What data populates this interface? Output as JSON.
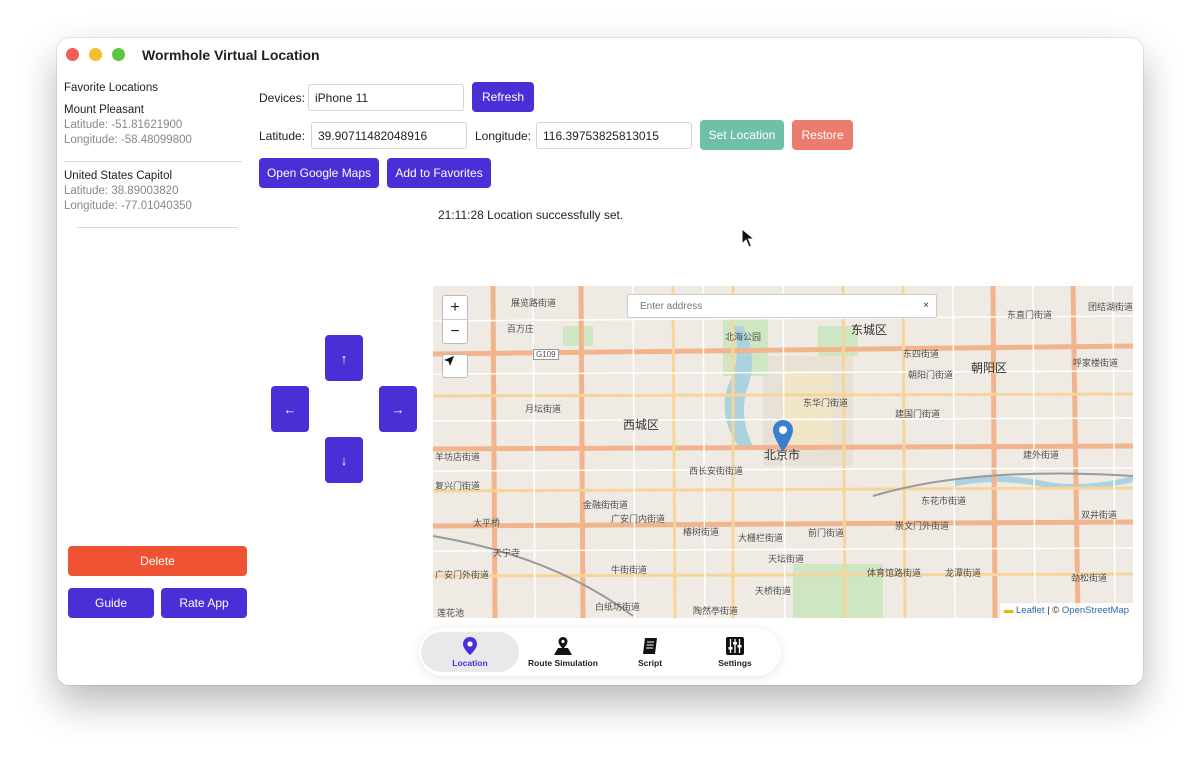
{
  "window": {
    "title": "Wormhole Virtual Location"
  },
  "sidebar": {
    "header": "Favorite Locations",
    "favorites": [
      {
        "name": "Mount Pleasant",
        "latitude": "Latitude: -51.81621900",
        "longitude": "Longitude: -58.48099800"
      },
      {
        "name": "United States Capitol",
        "latitude": "Latitude: 38.89003820",
        "longitude": "Longitude: -77.01040350"
      }
    ],
    "delete_label": "Delete",
    "guide_label": "Guide",
    "rate_label": "Rate App"
  },
  "controls": {
    "devices_label": "Devices:",
    "device_value": "iPhone 11",
    "refresh_label": "Refresh",
    "latitude_label": "Latitude:",
    "latitude_value": "39.90711482048916",
    "longitude_label": "Longitude:",
    "longitude_value": "116.39753825813015",
    "set_location_label": "Set Location",
    "restore_label": "Restore",
    "google_maps_label": "Open Google Maps",
    "add_favorites_label": "Add to Favorites",
    "status_text": "21:11:28 Location successfully set."
  },
  "dpad": {
    "up": "↑",
    "down": "↓",
    "left": "←",
    "right": "→"
  },
  "map": {
    "search_placeholder": "Enter address",
    "clear_symbol": "×",
    "zoom_in": "+",
    "zoom_out": "−",
    "attribution_leaflet": "Leaflet",
    "attribution_sep": " | © ",
    "attribution_osm": "OpenStreetMap",
    "labels": {
      "dongcheng": "东城区",
      "xicheng": "西城区",
      "chaoyang": "朝阳区",
      "beijing": "北京市",
      "zhanlan": "展览路街道",
      "beihaigongyuan": "北海公园",
      "baizhifang": "百万庄",
      "yuetan": "月坛街道",
      "fuxingmen": "复兴门街道",
      "xichang": "西长安街街道",
      "donghuamen": "东华门街道",
      "jiangguomen": "建国门街道",
      "chaoyangmen": "朝阳门街道",
      "dongzhimen": "东直门街道",
      "tuanjiehu": "团结湖街道",
      "hujialou": "呼家楼街道",
      "jianwai": "建外街道",
      "dongfengqiao": "东花市街道",
      "chongwen": "崇文门外街道",
      "qianmen": "前门街道",
      "dashilan": "大栅栏街道",
      "tianqiao": "天坛街道",
      "guanganmen": "广安门内街道",
      "chunshu": "椿树街道",
      "niujie": "牛街街道",
      "baizhi": "白纸坊街道",
      "taoranting": "陶然亭街道",
      "tiyuguan": "体育馆路街道",
      "longtan": "龙潭街道",
      "tianqiao2": "天桥街道",
      "shuangjing": "双井街道",
      "jinsong": "劲松街道",
      "lianhuachi": "莲花池",
      "guanganwai": "广安门外街道",
      "yangfangdian": "羊坊店街道",
      "dongsi": "东四街道",
      "jinrong": "金融街街道",
      "tianningsi": "天宁寺",
      "taipingqiao": "太平桥",
      "G109": "G109"
    }
  },
  "tabs": [
    {
      "label": "Location"
    },
    {
      "label": "Route Simulation"
    },
    {
      "label": "Script"
    },
    {
      "label": "Settings"
    }
  ]
}
